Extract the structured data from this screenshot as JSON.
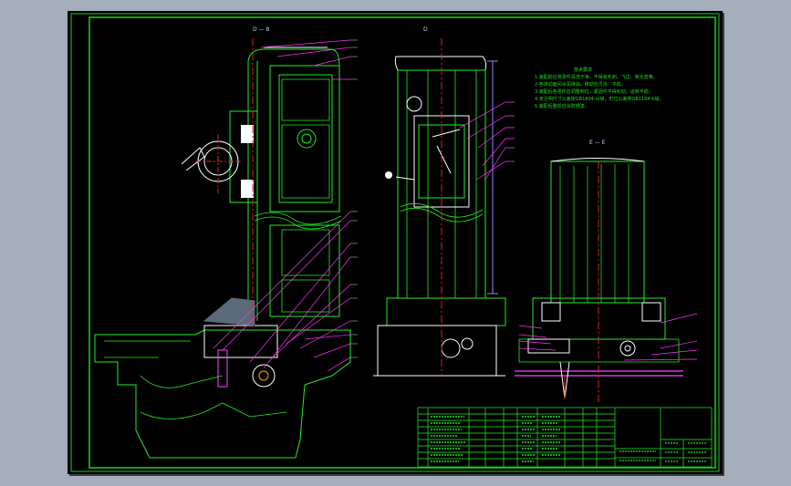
{
  "colors": {
    "background": "#a5aebb",
    "sheet": "#000000",
    "frame": "#22cc22",
    "outline": "#22ee22",
    "leader": "#ff33ff",
    "centerline": "#dd2222",
    "dimension": "#8888ff",
    "detail": "#ffffff",
    "hatch": "#ff44ff"
  },
  "views": {
    "left_section": "D — B",
    "middle_view": "D",
    "right_section": "E — E"
  },
  "notes_title": "技术要求",
  "notes_lines": [
    "1.装配前应将零件清洗干净，不得有毛刺、飞边、氧化皮等。",
    "2.各滑动面间涂润滑油，移动应灵活、平稳。",
    "3.装配后各零件应调整到位，紧固件不得松动，运转平稳。",
    "4.未注明尺寸公差按GB1804-m级，形位公差按GB1184-K级。",
    "5.装配后整机应涂防锈漆。"
  ],
  "icons": {
    "handwheel": "handwheel-icon",
    "locking_lever": "locking-lever-icon"
  }
}
